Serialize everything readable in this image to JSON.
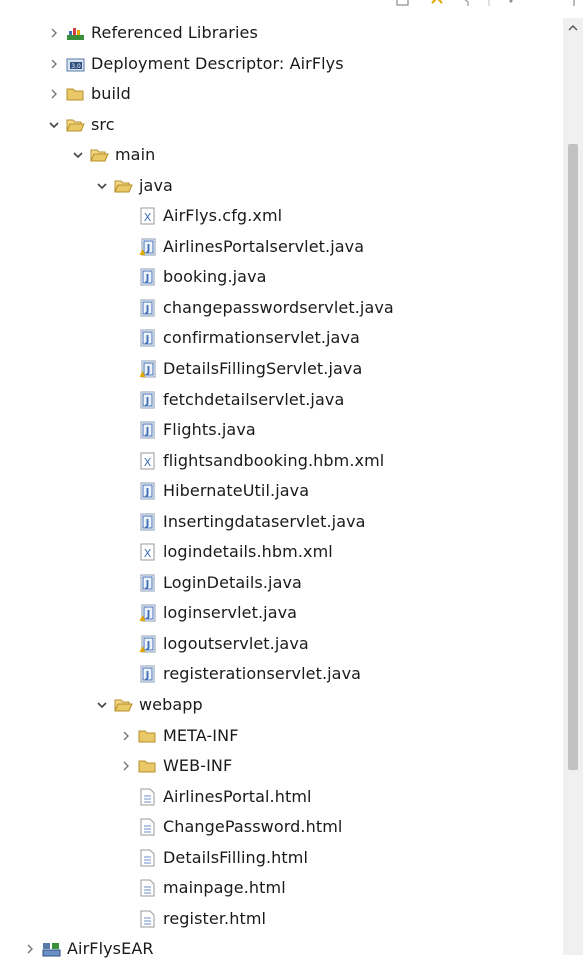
{
  "tree": {
    "nodes": [
      {
        "label": "Referenced Libraries",
        "icon": "library-icon",
        "expanded": false
      },
      {
        "label": "Deployment Descriptor: AirFlys",
        "icon": "deployment-descriptor-icon",
        "expanded": false
      },
      {
        "label": "build",
        "icon": "folder-icon",
        "expanded": false
      },
      {
        "label": "src",
        "icon": "folder-open-icon",
        "expanded": true
      },
      {
        "label": "main",
        "icon": "folder-open-icon",
        "expanded": true
      },
      {
        "label": "java",
        "icon": "folder-open-icon",
        "expanded": true
      },
      {
        "label": "AirFlys.cfg.xml",
        "icon": "xml-file-icon"
      },
      {
        "label": "AirlinesPortalservlet.java",
        "icon": "java-file-warning-icon"
      },
      {
        "label": "booking.java",
        "icon": "java-file-icon"
      },
      {
        "label": "changepasswordservlet.java",
        "icon": "java-file-icon"
      },
      {
        "label": "confirmationservlet.java",
        "icon": "java-file-icon"
      },
      {
        "label": "DetailsFillingServlet.java",
        "icon": "java-file-warning-icon"
      },
      {
        "label": "fetchdetailservlet.java",
        "icon": "java-file-icon"
      },
      {
        "label": "Flights.java",
        "icon": "java-file-icon"
      },
      {
        "label": "flightsandbooking.hbm.xml",
        "icon": "xml-file-icon"
      },
      {
        "label": "HibernateUtil.java",
        "icon": "java-file-icon"
      },
      {
        "label": "Insertingdataservlet.java",
        "icon": "java-file-icon"
      },
      {
        "label": "logindetails.hbm.xml",
        "icon": "xml-file-icon"
      },
      {
        "label": "LoginDetails.java",
        "icon": "java-file-icon"
      },
      {
        "label": "loginservlet.java",
        "icon": "java-file-warning-icon"
      },
      {
        "label": "logoutservlet.java",
        "icon": "java-file-warning-icon"
      },
      {
        "label": "registerationservlet.java",
        "icon": "java-file-icon"
      },
      {
        "label": "webapp",
        "icon": "folder-open-icon",
        "expanded": true
      },
      {
        "label": "META-INF",
        "icon": "folder-icon",
        "expanded": false
      },
      {
        "label": "WEB-INF",
        "icon": "folder-icon",
        "expanded": false
      },
      {
        "label": "AirlinesPortal.html",
        "icon": "html-file-icon"
      },
      {
        "label": "ChangePassword.html",
        "icon": "html-file-icon"
      },
      {
        "label": "DetailsFilling.html",
        "icon": "html-file-icon"
      },
      {
        "label": "mainpage.html",
        "icon": "html-file-icon"
      },
      {
        "label": "register.html",
        "icon": "html-file-icon"
      },
      {
        "label": "AirFlysEAR",
        "icon": "ear-project-icon",
        "expanded": false
      }
    ]
  },
  "colors": {
    "folder": "#e8c867",
    "folder_stroke": "#b8902a",
    "java": "#3f6fb5",
    "warning": "#e0a800",
    "scrollbar_thumb": "#c2c2c2"
  }
}
